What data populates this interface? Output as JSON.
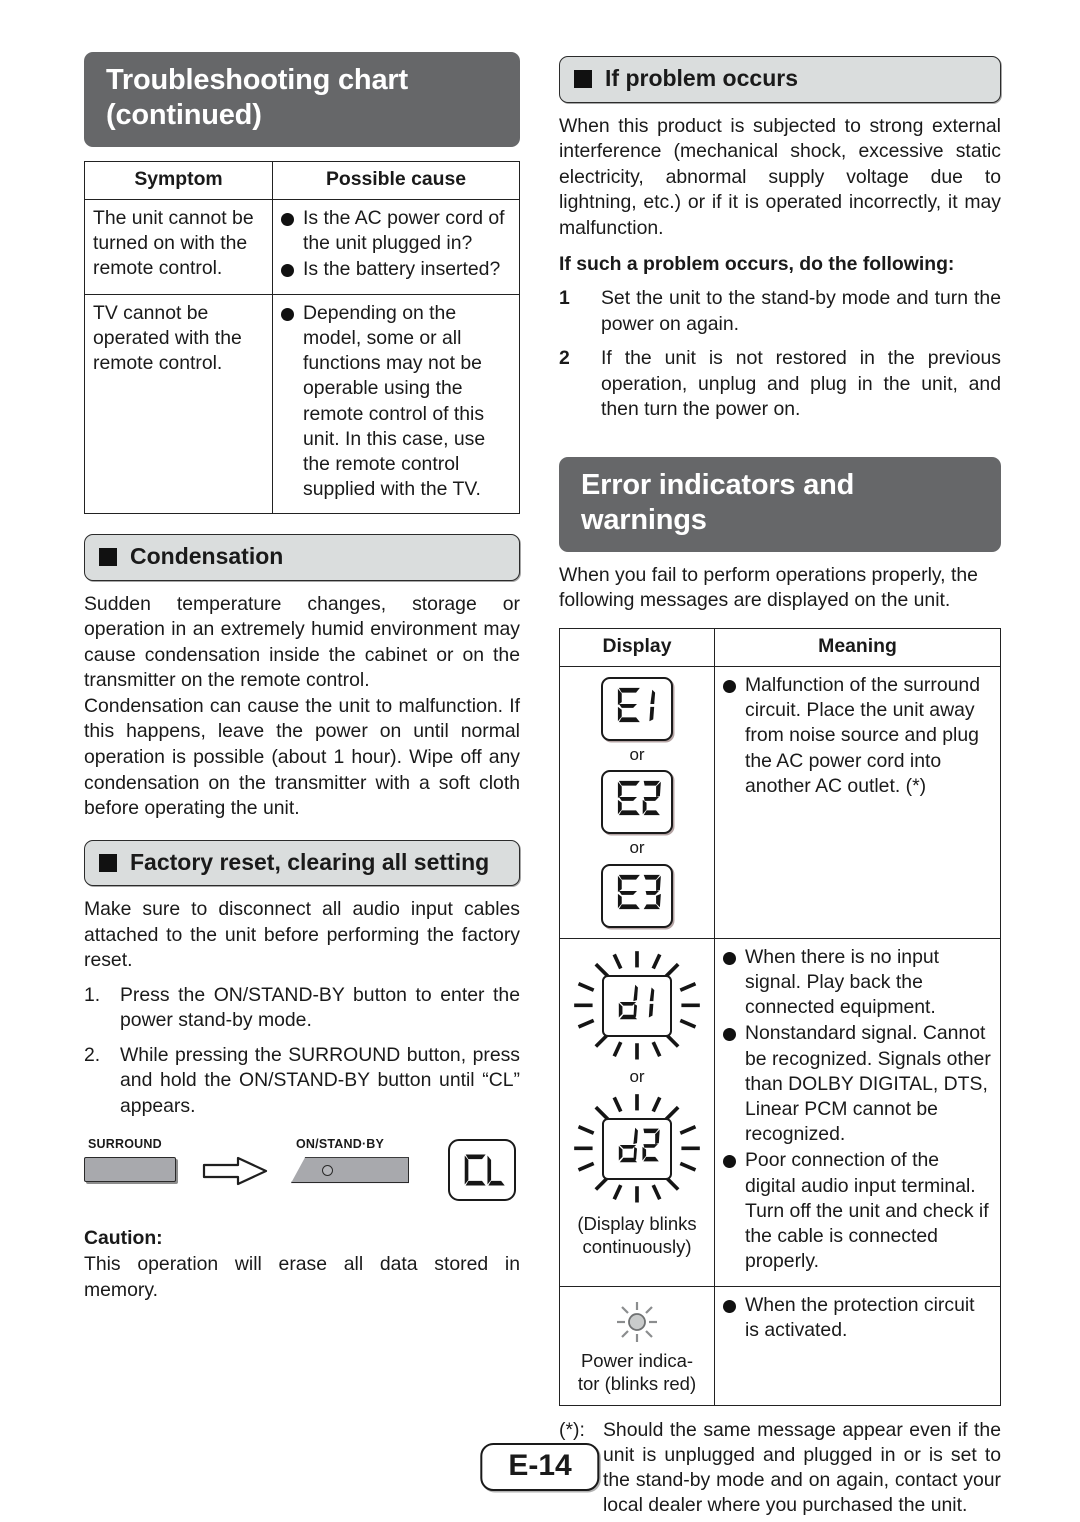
{
  "page": {
    "number_label": "E-14"
  },
  "left_column": {
    "chapter_banner": "Troubleshooting chart (continued)",
    "troubleshooting_table": {
      "headers": [
        "Symptom",
        "Possible cause"
      ],
      "rows": [
        {
          "symptom": "The unit cannot be turned on with the remote control.",
          "causes": [
            "Is the AC power cord of the unit plugged in?",
            "Is the battery inserted?"
          ]
        },
        {
          "symptom": "TV cannot be operated with the remote control.",
          "causes": [
            "Depending on the model, some or all functions may not be operable using the remote control of this unit. In this case, use the remote control supplied with the TV."
          ]
        }
      ]
    },
    "condensation": {
      "header": "Condensation",
      "paragraph_1": "Sudden temperature changes, storage or operation in an extremely humid environment may cause condensation inside the cabinet or on the transmitter on the remote control.",
      "paragraph_2": "Condensation can cause the unit to malfunction. If this happens, leave the power on until normal operation is possible (about 1 hour). Wipe off any condensation on the transmitter with a soft cloth before operating the unit."
    },
    "factory_reset": {
      "header": "Factory reset, clearing all setting",
      "intro": "Make sure to disconnect all audio input cables attached to the unit before performing the factory reset.",
      "steps": [
        {
          "num": "1.",
          "text": "Press the ON/STAND-BY button to enter the power stand-by mode."
        },
        {
          "num": "2.",
          "text": "While pressing the SURROUND button, press and hold the ON/STAND-BY button until “CL” appears."
        }
      ],
      "diagram": {
        "surround_label": "SURROUND",
        "standby_label": "ON/STAND·BY",
        "display_text": "CL"
      },
      "caution_label": "Caution:",
      "caution_text": "This operation will erase all data stored in memory."
    }
  },
  "right_column": {
    "if_problem_occurs": {
      "header": "If problem occurs",
      "paragraph": "When this product is subjected to strong external interference (mechanical shock, excessive static electricity, abnormal supply voltage due to lightning, etc.) or if it is operated incorrectly, it may malfunction.",
      "lead_in": "If such a problem occurs, do the following:",
      "steps": [
        {
          "num": "1",
          "text": "Set the unit to the stand-by mode and turn the power on again."
        },
        {
          "num": "2",
          "text": "If the unit is not restored in the previous operation, unplug and plug in the unit, and then turn the power on."
        }
      ]
    },
    "error_indicators": {
      "chapter_banner": "Error indicators and warnings",
      "intro": "When you fail to perform operations properly, the following messages are displayed on the unit.",
      "table": {
        "headers": [
          "Display",
          "Meaning"
        ],
        "rows": [
          {
            "display_codes": [
              "E 1",
              "E 2",
              "E 3"
            ],
            "or_label": "or",
            "blinking": false,
            "meanings": [
              "Malfunction of the surround circuit. Place the unit away from noise source and plug the AC power cord into another AC outlet. (*)"
            ]
          },
          {
            "display_codes": [
              "d 1",
              "d 2"
            ],
            "or_label": "or",
            "blinking": true,
            "caption": "(Display blinks continuously)",
            "meanings": [
              "When there is no input signal. Play back the connected equipment.",
              "Nonstandard signal. Cannot be recognized. Signals other than DOLBY DIGITAL, DTS, Linear PCM cannot be recognized.",
              "Poor connection of the digital audio input terminal. Turn off the unit and check if the cable is connected properly."
            ]
          },
          {
            "display_icon": "power-indicator-blinking",
            "caption": "Power indica- tor (blinks red)",
            "meanings": [
              "When the protection circuit is activated."
            ]
          }
        ]
      },
      "footnote_mark": "(*):",
      "footnote_text": "Should the same message appear even if the unit is unplugged and plugged in or is set to the stand-by mode and on again, contact your local dealer where you purchased the unit."
    }
  },
  "colors": {
    "chapter_banner_bg": "#666769",
    "section_header_bg": "#dadddd",
    "rule": "#222222",
    "button_face": "#a8a9ad"
  }
}
